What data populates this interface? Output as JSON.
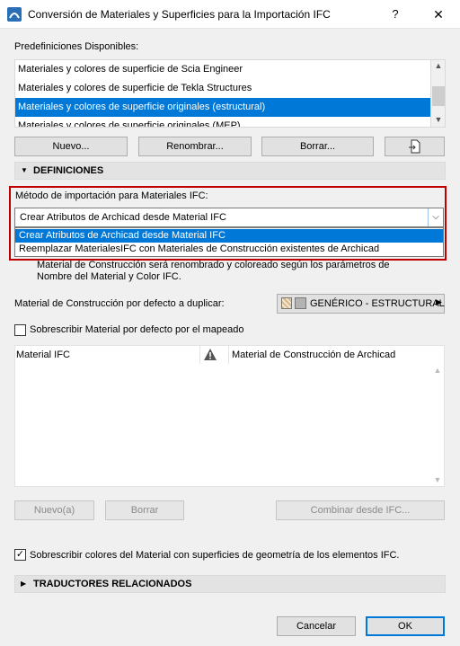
{
  "window": {
    "title": "Conversión de Materiales y Superficies para la Importación IFC",
    "help_label": "?",
    "close_label": "✕"
  },
  "presets": {
    "label": "Predefiniciones Disponibles:",
    "items": [
      "Materiales y colores de superficie de Scia Engineer",
      "Materiales y colores de superficie de Tekla Structures",
      "Materiales y colores de superficie originales (estructural)",
      "Materiales y colores de superficie originales (MEP)"
    ],
    "selected_index": 2,
    "new_label": "Nuevo...",
    "rename_label": "Renombrar...",
    "delete_label": "Borrar..."
  },
  "definitions": {
    "section_label": "DEFINICIONES",
    "method_label": "Método de importación para Materiales IFC:",
    "combo_value": "Crear Atributos de Archicad desde Material IFC",
    "options": [
      "Crear Atributos de Archicad desde Material IFC",
      "Reemplazar MaterialesIFC con Materiales de Construcción existentes de Archicad"
    ],
    "desc_line1": "Material de Construcción será renombrado y coloreado según los parámetros de",
    "desc_line2": "Nombre del Material y Color IFC.",
    "default_material_label": "Material de Construcción por defecto a duplicar:",
    "default_material_value": "GENÉRICO - ESTRUCTURAL",
    "overwrite_default_label": "Sobrescribir Material por defecto por el mapeado",
    "overwrite_default_checked": false,
    "table_col1": "Material IFC",
    "table_col3": "Material de Construcción de Archicad",
    "new_btn": "Nuevo(a)",
    "delete_btn": "Borrar",
    "combine_btn": "Combinar desde IFC...",
    "overwrite_colors_label": "Sobrescribir colores del Material con superficies de geometría de los elementos IFC.",
    "overwrite_colors_checked": true
  },
  "translators": {
    "section_label": "TRADUCTORES RELACIONADOS"
  },
  "footer": {
    "cancel_label": "Cancelar",
    "ok_label": "OK"
  },
  "colors": {
    "accent": "#0078d7",
    "highlight_box": "#c00000"
  }
}
